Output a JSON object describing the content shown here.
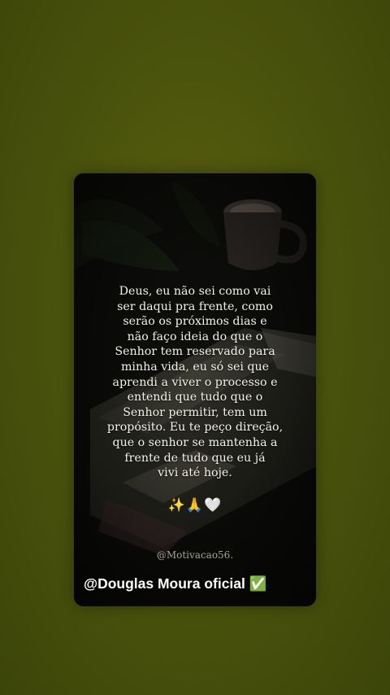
{
  "post": {
    "quote": "Deus, eu não sei como vai\nser daqui pra frente, como\nserão os próximos dias e\nnão faço ideia do que o\nSenhor tem reservado para\nminha vida, eu só sei que\naprendi a viver o processo e\nentendi que tudo que o\nSenhor permitir, tem um\npropósito. Eu te peço direção,\nque o senhor se mantenha a\nfrente de tudo que eu já\nvivi até hoje.",
    "emojis": "✨🙏🤍",
    "handle": "@Motivacao56.",
    "signature": "@Douglas Moura oficial ✅"
  },
  "colors": {
    "background": "#4b540c",
    "card_background": "#0c0d0a",
    "quote_text": "#f4f1ea",
    "handle_text": "#a6a39b",
    "signature_text": "#ffffff"
  }
}
